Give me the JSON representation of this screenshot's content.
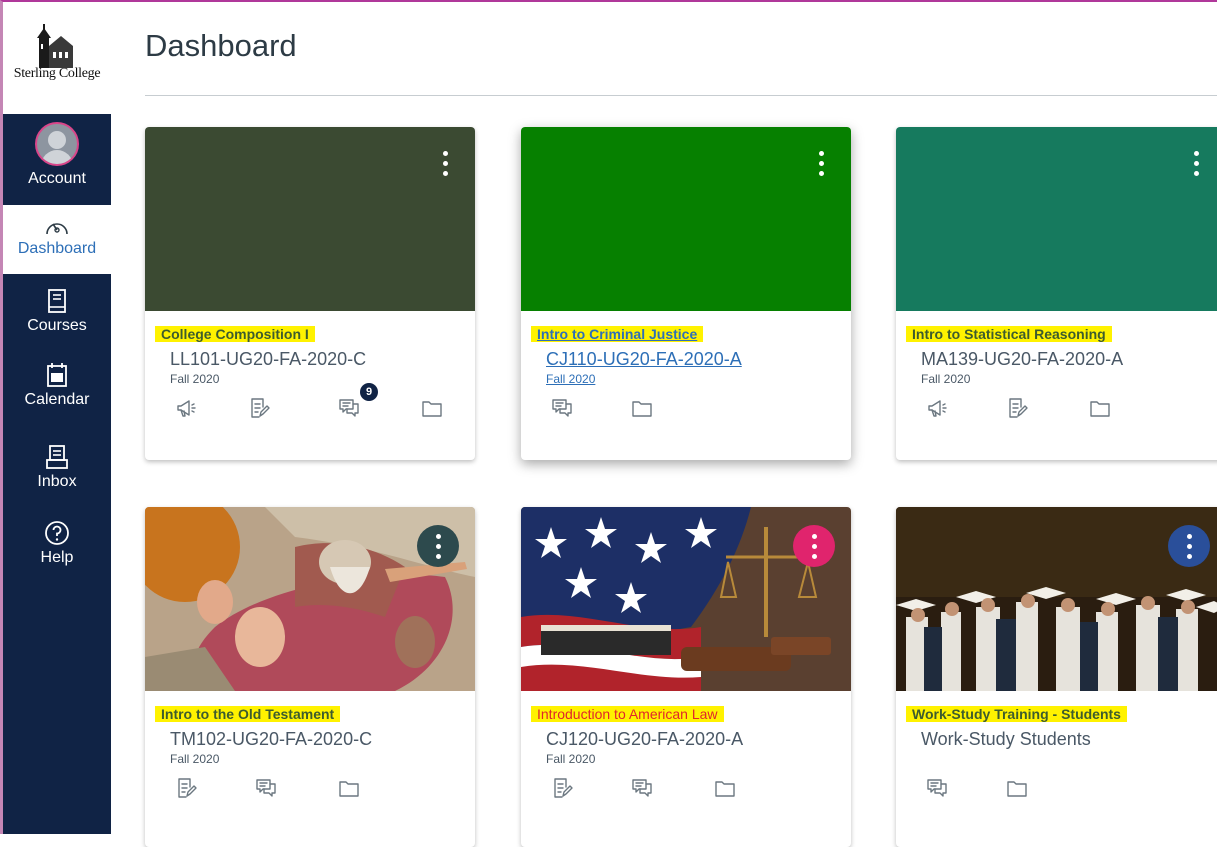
{
  "nav": {
    "logo_text": "Sterling College",
    "items": [
      {
        "label": "Account"
      },
      {
        "label": "Dashboard"
      },
      {
        "label": "Courses"
      },
      {
        "label": "Calendar"
      },
      {
        "label": "Inbox"
      },
      {
        "label": "Help"
      }
    ],
    "active": "Dashboard"
  },
  "header": {
    "title": "Dashboard"
  },
  "cards": [
    {
      "name": "College Composition I",
      "code": "LL101-UG20-FA-2020-C",
      "term": "Fall 2020",
      "color": "#3b4a32",
      "badge": "9",
      "icons": [
        "announcements-icon",
        "assignments-icon",
        "discussions-icon",
        "files-icon"
      ]
    },
    {
      "name": "Intro to Criminal Justice",
      "code": "CJ110-UG20-FA-2020-A",
      "term": "Fall 2020",
      "color": "#068000",
      "icons": [
        "discussions-icon",
        "files-icon"
      ]
    },
    {
      "name": "Intro to Statistical Reasoning",
      "code": "MA139-UG20-FA-2020-A",
      "term": "Fall 2020",
      "color": "#167a5e",
      "icons": [
        "announcements-icon",
        "assignments-icon",
        "files-icon"
      ]
    },
    {
      "name": "Intro to the Old Testament",
      "code": "TM102-UG20-FA-2020-C",
      "term": "Fall 2020",
      "kebab_color": "#2d4a4d",
      "icons": [
        "assignments-icon",
        "discussions-icon",
        "files-icon"
      ]
    },
    {
      "name": "Introduction to American Law",
      "code": "CJ120-UG20-FA-2020-A",
      "term": "Fall 2020",
      "kebab_color": "#e0246d",
      "icons": [
        "assignments-icon",
        "discussions-icon",
        "files-icon"
      ]
    },
    {
      "name": "Work-Study Training - Students",
      "code": "Work-Study Students",
      "kebab_color": "#2a4f9a",
      "icons": [
        "discussions-icon",
        "files-icon"
      ]
    }
  ]
}
